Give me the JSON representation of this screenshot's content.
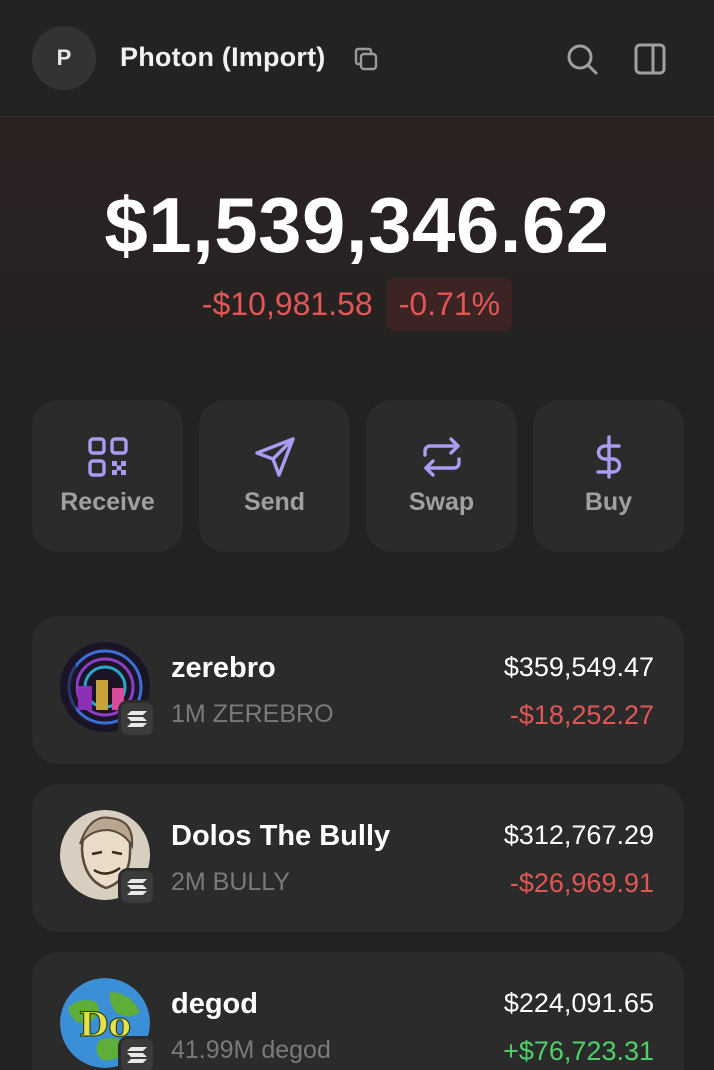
{
  "header": {
    "avatar_initial": "P",
    "account_name": "Photon (Import)"
  },
  "portfolio": {
    "balance": "$1,539,346.62",
    "change_amount": "-$10,981.58",
    "change_percent": "-0.71%"
  },
  "actions": [
    {
      "label": "Receive",
      "icon": "qr-code-icon"
    },
    {
      "label": "Send",
      "icon": "send-arrow-icon"
    },
    {
      "label": "Swap",
      "icon": "swap-arrows-icon"
    },
    {
      "label": "Buy",
      "icon": "dollar-icon"
    }
  ],
  "tokens": [
    {
      "name": "zerebro",
      "quantity": "1M ZEREBRO",
      "value": "$359,549.47",
      "change": "-$18,252.27",
      "direction": "negative"
    },
    {
      "name": "Dolos The Bully",
      "quantity": "2M BULLY",
      "value": "$312,767.29",
      "change": "-$26,969.91",
      "direction": "negative"
    },
    {
      "name": "degod",
      "quantity": "41.99M degod",
      "value": "$224,091.65",
      "change": "+$76,723.31",
      "direction": "positive"
    }
  ],
  "colors": {
    "accent": "#a99cf2",
    "negative": "#e25656",
    "positive": "#4fd06b",
    "card": "#2b2b2b",
    "background": "#222222"
  }
}
